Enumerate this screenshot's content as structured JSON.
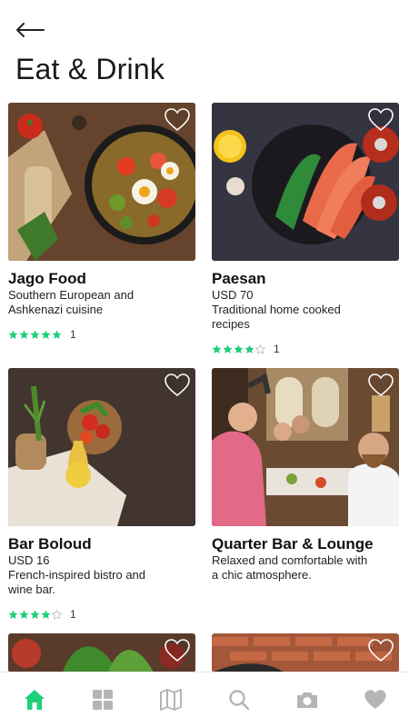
{
  "header": {
    "title": "Eat & Drink"
  },
  "colors": {
    "accent": "#1fcf7a",
    "star_empty": "#c8c8c8",
    "icon_inactive": "#b5b5b5"
  },
  "cards": [
    {
      "name": "Jago Food",
      "price": "",
      "desc1": "Southern European and",
      "desc2": "Ashkenazi cuisine",
      "rating": 5,
      "count": "1"
    },
    {
      "name": "Paesan",
      "price": "USD 70",
      "desc1": "Traditional home cooked",
      "desc2": "recipes",
      "rating": 4,
      "count": "1"
    },
    {
      "name": "Bar Boloud",
      "price": "USD 16",
      "desc1": "French-inspired bistro and",
      "desc2": "wine bar.",
      "rating": 4,
      "count": "1"
    },
    {
      "name": "Quarter Bar & Lounge",
      "price": "",
      "desc1": "Relaxed and comfortable with",
      "desc2": "a chic atmosphere.",
      "rating": null,
      "count": ""
    }
  ],
  "tabbar": {
    "items": [
      "home-icon",
      "grid-icon",
      "map-icon",
      "search-icon",
      "camera-icon",
      "heart-icon"
    ],
    "active": "home-icon"
  }
}
